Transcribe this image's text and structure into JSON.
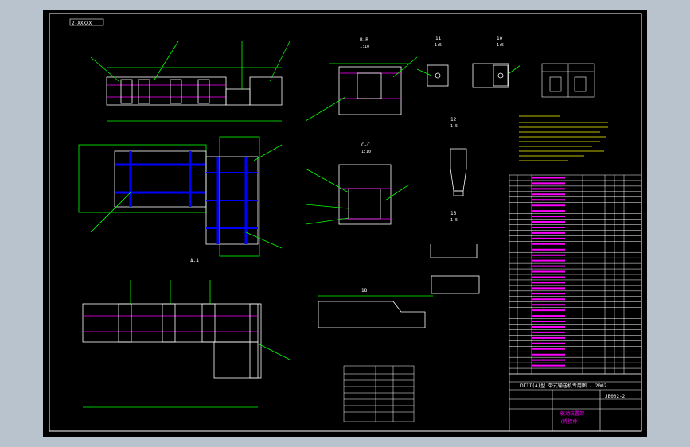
{
  "sheet": {
    "tag": "2-XXXXX"
  },
  "views": {
    "view_b": {
      "title": "B-B",
      "scale": "1:10"
    },
    "view_c": {
      "title": "C-C",
      "scale": "1:10"
    },
    "view_a": {
      "title": "A-A"
    },
    "detail_11": {
      "title": "11",
      "scale": "1:5"
    },
    "detail_10": {
      "title": "10",
      "scale": "1:5"
    },
    "detail_12": {
      "title": "12",
      "scale": "1:5"
    },
    "detail_16": {
      "title": "16",
      "scale": "1:5"
    },
    "detail_18": {
      "title": "18"
    }
  },
  "title_block": {
    "product_title": "DTII(A)型 带式输送机专用图 - 2002",
    "drawing_no": "JB002-2",
    "part_name_line1": "驱动装置架",
    "part_name_line2": "(焊接件)"
  },
  "colors": {
    "background": "#000000",
    "outline": "#ffffff",
    "dimension": "#00ff00",
    "table": "#ff00ff",
    "hidden": "#0000ff",
    "frame": "#b9c3cd"
  }
}
